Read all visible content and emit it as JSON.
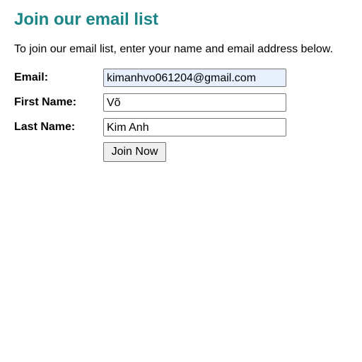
{
  "page": {
    "heading": "Join our email list",
    "intro": "To join our email list, enter your name and email address below."
  },
  "form": {
    "email": {
      "label": "Email:",
      "value": "kimanhvo061204@gmail.com"
    },
    "first_name": {
      "label": "First Name:",
      "value": "Võ"
    },
    "last_name": {
      "label": "Last Name:",
      "value": "Kim Anh"
    },
    "submit_label": "Join Now"
  },
  "colors": {
    "heading": "#1b8585",
    "autofill_background": "#e8f0fe"
  }
}
